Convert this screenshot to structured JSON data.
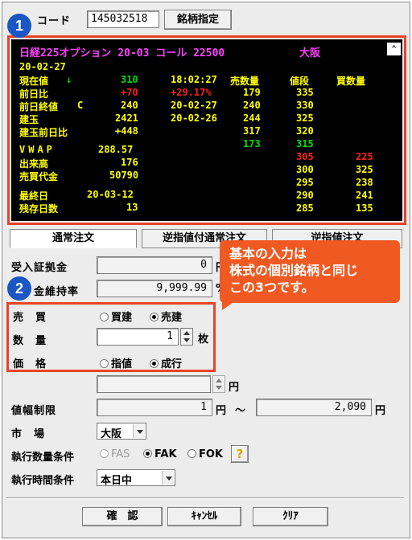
{
  "markers": {
    "one": "1",
    "two": "2"
  },
  "code": {
    "label": "コード",
    "value": "145032518",
    "button": "銘柄指定"
  },
  "board": {
    "title": "日経225オプション 20-03 コール 22500",
    "exchange": "大阪",
    "date": "20-02-27",
    "current_label": "現在値",
    "current_arrow": "↓",
    "current_value": "310",
    "time": "18:02:27",
    "hdr_sell_qty": "売数量",
    "hdr_price": "値段",
    "hdr_buy_qty": "買数量",
    "prev_diff_label": "前日比",
    "prev_diff_value": "+70",
    "prev_diff_pct": "+29.17%",
    "prev_close_label": "前日終値",
    "prev_close_flag": "C",
    "prev_close_value": "240",
    "prev_close_date": "20-02-27",
    "oi_label": "建玉",
    "oi_value": "2421",
    "oi_date": "20-02-26",
    "oi_diff_label": "建玉前日比",
    "oi_diff_value": "+448",
    "vwap_label": "VWAP",
    "vwap_value": "288.57",
    "volume_label": "出来高",
    "volume_value": "176",
    "turnover_label": "売買代金",
    "turnover_value": "50790",
    "last_day_label": "最終日",
    "last_day_value": "20-03-12",
    "days_left_label": "残存日数",
    "days_left_value": "13",
    "asks": [
      {
        "qty": "179",
        "price": "335"
      },
      {
        "qty": "240",
        "price": "330"
      },
      {
        "qty": "244",
        "price": "325"
      },
      {
        "qty": "317",
        "price": "320"
      },
      {
        "qty": "173",
        "price": "315"
      }
    ],
    "bids": [
      {
        "price": "305",
        "qty": "225"
      },
      {
        "price": "300",
        "qty": "325"
      },
      {
        "price": "295",
        "qty": "238"
      },
      {
        "price": "290",
        "qty": "241"
      },
      {
        "price": "285",
        "qty": "135"
      }
    ]
  },
  "tabs": [
    "通常注文",
    "逆指値付通常注文",
    "逆指値注文"
  ],
  "callout": {
    "line1": "基本の入力は",
    "line2": "株式の個別銘柄と同じ",
    "line3": "この3つです。"
  },
  "margin": {
    "label": "受入証拠金",
    "value": "0",
    "unit": "円"
  },
  "maint": {
    "label": "金維持率",
    "value": "9,999.99",
    "unit": "%"
  },
  "side": {
    "label": "売　買",
    "buy": "買建",
    "sell": "売建"
  },
  "qty": {
    "label": "数　量",
    "value": "1",
    "unit": "枚"
  },
  "price_type": {
    "label": "価　格",
    "limit": "指値",
    "market": "成行"
  },
  "price_input": {
    "unit": "円"
  },
  "range": {
    "label": "値幅制限",
    "low": "1",
    "high": "2,090",
    "unit": "円",
    "tilde": "〜"
  },
  "market": {
    "label": "市　場",
    "value": "大阪"
  },
  "exec_cond": {
    "label": "執行数量条件",
    "fas": "FAS",
    "fak": "FAK",
    "fok": "FOK",
    "help": "?"
  },
  "time_cond": {
    "label": "執行時間条件",
    "value": "本日中"
  },
  "buttons": {
    "confirm": "確　認",
    "cancel": "ｷｬﾝｾﾙ",
    "clear": "ｸﾘｱ"
  }
}
